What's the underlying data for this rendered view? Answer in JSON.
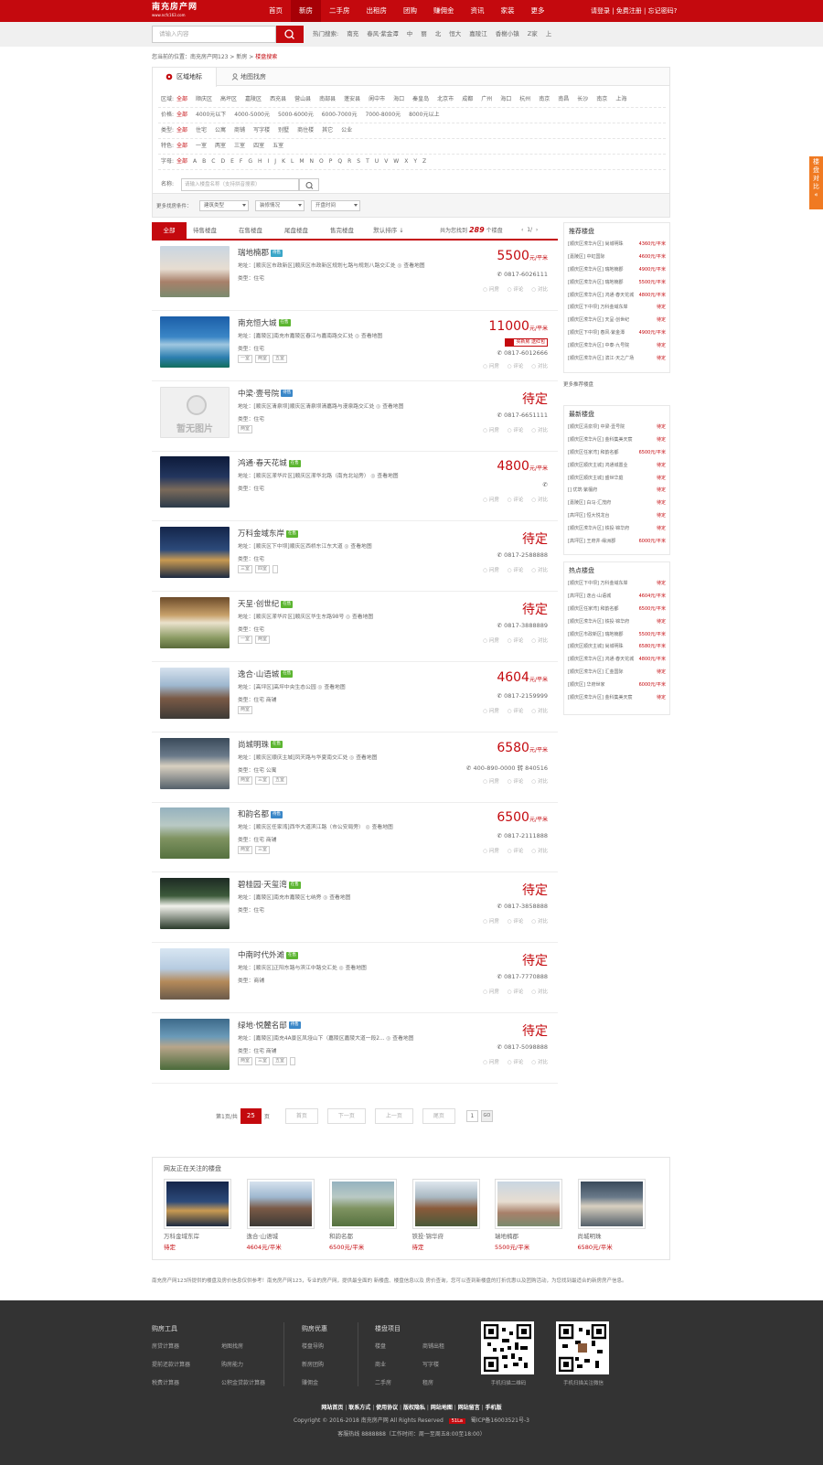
{
  "header": {
    "logo_text": "南充房产网",
    "logo_sub": "www.ncfc163.com",
    "nav": [
      "首页",
      "新房",
      "二手房",
      "出租房",
      "团购",
      "赚佣金",
      "资讯",
      "家装",
      "更多"
    ],
    "active_nav": 1,
    "login": "请登录",
    "register": "免费注册",
    "forgot": "忘记密码?"
  },
  "search": {
    "placeholder": "请输入内容",
    "hot_label": "热门搜索:",
    "hot_words": [
      "南充",
      "春风·紫金潭",
      "中",
      "丽",
      "北",
      "恒大",
      "嘉陵江",
      "香榭小镇",
      "Z家",
      "上"
    ]
  },
  "breadcrumb": {
    "prefix": "您当前的位置：",
    "site": "南充房产网123",
    "section": "新房",
    "current": "楼盘搜索",
    "sep": ">"
  },
  "filters": {
    "tabs": [
      "区域地标",
      "地图找房"
    ],
    "region": {
      "label": "区域:",
      "options": [
        "全部",
        "顺庆区",
        "高坪区",
        "嘉陵区",
        "西充县",
        "营山县",
        "南部县",
        "蓬安县",
        "阆中市",
        "海口",
        "秦皇岛",
        "北京市",
        "成都",
        "广州",
        "海口",
        "杭州",
        "南京",
        "南昌",
        "长沙",
        "南京",
        "上海"
      ]
    },
    "price": {
      "label": "价格:",
      "options": [
        "全部",
        "4000元以下",
        "4000-5000元",
        "5000-6000元",
        "6000-7000元",
        "7000-8000元",
        "8000元以上"
      ]
    },
    "type": {
      "label": "类型:",
      "options": [
        "全部",
        "住宅",
        "公寓",
        "商铺",
        "写字楼",
        "别墅",
        "商住楼",
        "其它",
        "公业"
      ]
    },
    "feature": {
      "label": "特色:",
      "options": [
        "全部",
        "一室",
        "两室",
        "三室",
        "四室",
        "五室"
      ]
    },
    "letter": {
      "label": "字母:",
      "options": [
        "全部",
        "A",
        "B",
        "C",
        "D",
        "E",
        "F",
        "G",
        "H",
        "I",
        "J",
        "K",
        "L",
        "M",
        "N",
        "O",
        "P",
        "Q",
        "R",
        "S",
        "T",
        "U",
        "V",
        "W",
        "X",
        "Y",
        "Z"
      ]
    },
    "name": {
      "label": "名称:",
      "placeholder": "请输入楼盘名称（支持拼音搜索）"
    },
    "more_label": "更多找房条件：",
    "selects": [
      "建筑类型",
      "装修情况",
      "开盘时间"
    ]
  },
  "list": {
    "tabs": [
      "全部",
      "待售楼盘",
      "在售楼盘",
      "尾盘楼盘",
      "售完楼盘"
    ],
    "sort": "默认排序 ↓",
    "total_prefix": "共为您找到",
    "total": "289",
    "total_suffix": "个楼盘",
    "page": "1/",
    "items": [
      {
        "name": "瑞地楠郡",
        "badge": "待售",
        "badge_color": "#3aa6c8",
        "addr": "地址：[顺庆区市政新区]顺庆区市政新区规划七路与规划八路交汇处",
        "map": "查看地图",
        "type": "类型：住宅",
        "tags": [],
        "price": "5500",
        "unit": "元/平米",
        "phone": "0817-6026111",
        "img": "linear-gradient(180deg,#c9d6e2 0%,#e7ddd1 45%,#a8806a 70%,#7a8a6e 100%)"
      },
      {
        "name": "南充恒大城",
        "badge": "在售",
        "badge_color": "#5cb531",
        "addr": "地址：[嘉陵区]南充市嘉陵区春江与嘉南路交汇处",
        "map": "查看地图",
        "type": "类型：住宅",
        "tags": [
          "一室",
          "两室",
          "五室"
        ],
        "price": "11000",
        "unit": "元/平米",
        "phone": "0817-6012666",
        "promo": "买新房 送红包",
        "img": "linear-gradient(180deg,#1b5ea8 0%,#3a86c6 40%,#9fc7e0 55%,#2d7fb0 80%,#126e5c 100%)"
      },
      {
        "name": "中梁·壹号院",
        "badge": "待售",
        "badge_color": "#3a87c8",
        "addr": "地址：[顺庆区清泉坝]顺庆区清泉坝清嘉路与漫泉路交汇处",
        "map": "查看地图",
        "type": "类型：住宅",
        "tags": [
          "两室"
        ],
        "price": "待定",
        "unit": "",
        "phone": "0817-6651111",
        "noimg": true,
        "noimg_text": "暂无图片"
      },
      {
        "name": "鸿通·春天花城",
        "badge": "在售",
        "badge_color": "#5cb531",
        "addr": "地址：[顺庆区潆华片区]顺庆区潆华北路（南充北站旁）",
        "map": "查看地图",
        "type": "类型：住宅",
        "tags": [],
        "price": "4800",
        "unit": "元/平米",
        "phone": "",
        "img": "linear-gradient(180deg,#0d1a3a 0%,#23365e 40%,#7a6a5a 65%,#2b3a4a 100%)"
      },
      {
        "name": "万科金域东岸",
        "badge": "在售",
        "badge_color": "#5cb531",
        "addr": "地址：[顺庆区下中坝]顺庆区西桥东江东大道",
        "map": "查看地图",
        "type": "类型：住宅",
        "tags": [
          "三室",
          "四室",
          ""
        ],
        "price": "待定",
        "unit": "",
        "phone": "0817-2588888",
        "img": "linear-gradient(180deg,#14254a 0%,#2c4a7a 45%,#c99a52 65%,#1c2a42 100%)"
      },
      {
        "name": "天呈·创世纪",
        "badge": "在售",
        "badge_color": "#5cb531",
        "addr": "地址：[顺庆区潆华片区]顺庆区华生东路98号",
        "map": "查看地图",
        "type": "类型：住宅",
        "tags": [
          "一室",
          "两室"
        ],
        "price": "待定",
        "unit": "",
        "phone": "0817-3888889",
        "img": "linear-gradient(180deg,#6c4b2a 0%,#c7a06a 35%,#eae2cc 50%,#8a9a62 80%,#5a6a3a 100%)"
      },
      {
        "name": "逸合·山语城",
        "badge": "在售",
        "badge_color": "#5cb531",
        "addr": "地址：[高坪区]高坪中央生态公园",
        "map": "查看地图",
        "type": "类型：住宅 商铺",
        "tags": [
          "两室"
        ],
        "price": "4604",
        "unit": "元/平米",
        "phone": "0817-2159999",
        "img": "linear-gradient(180deg,#d6e2ee 0%,#9eb7cf 35%,#7a5a46 60%,#3d3a36 100%)"
      },
      {
        "name": "尚城明珠",
        "badge": "在售",
        "badge_color": "#5cb531",
        "addr": "地址：[顺庆区顺庆主城]凤天路与华夏南交汇处",
        "map": "查看地图",
        "type": "类型：住宅 公寓",
        "tags": [
          "两室",
          "三室",
          "五室"
        ],
        "price": "6580",
        "unit": "元/平米",
        "phone": "400-890-0000 转 840516",
        "img": "linear-gradient(180deg,#3a4a5a 0%,#6a7a8a 35%,#d8d0c0 55%,#54606a 100%)"
      },
      {
        "name": "和韵名都",
        "badge": "待售",
        "badge_color": "#3a87c8",
        "addr": "地址：[顺庆区任家湾]西华大道滨江路（市公安局旁）",
        "map": "查看地图",
        "type": "类型：住宅 商铺",
        "tags": [
          "两室",
          "三室"
        ],
        "price": "6500",
        "unit": "元/平米",
        "phone": "0817-2111888",
        "img": "linear-gradient(180deg,#95b2bf 0%,#b9c9c4 35%,#7f9361 60%,#55713f 100%)"
      },
      {
        "name": "碧桂园·天玺湾",
        "badge": "在售",
        "badge_color": "#5cb531",
        "addr": "地址：[嘉陵区]南充市嘉陵区七纳旁",
        "map": "查看地图",
        "type": "类型：住宅",
        "tags": [],
        "price": "待定",
        "unit": "",
        "phone": "0817-3858888",
        "img": "linear-gradient(180deg,#1d2a24 0%,#3c5a3a 35%,#f2f2ec 55%,#2a3a2a 100%)"
      },
      {
        "name": "中南时代外滩",
        "badge": "在售",
        "badge_color": "#5cb531",
        "addr": "地址：[顺庆区]正阳东路与滨江中路交汇处",
        "map": "查看地图",
        "type": "类型：商铺",
        "tags": [],
        "price": "待定",
        "unit": "",
        "phone": "0817-7770888",
        "img": "linear-gradient(180deg,#d8e6f2 0%,#b6cbe0 40%,#b58a5a 65%,#6a5a4a 100%)"
      },
      {
        "name": "绿地·悦麓名邸",
        "badge": "待售",
        "badge_color": "#3a87c8",
        "addr": "地址：[嘉陵区]南充4A景区凤垭山下（嘉陵区嘉陵大道一段2...",
        "map": "查看地图",
        "type": "类型：住宅 商铺",
        "tags": [
          "两室",
          "三室",
          "五室",
          ""
        ],
        "price": "待定",
        "unit": "",
        "phone": "0817-5098888",
        "img": "linear-gradient(180deg,#3d6a8a 0%,#6a9ab8 35%,#b8a58a 55%,#4a6a3a 100%)"
      }
    ],
    "actions": [
      "问房",
      "评论",
      "对比"
    ]
  },
  "sidebar": {
    "recommend": {
      "title": "推荐楼盘",
      "rows": [
        [
          "[顺庆区潆华片区] 尚城明珠",
          "4360元/平米"
        ],
        [
          "[嘉陵区] 中虹国际",
          "4600元/平米"
        ],
        [
          "[顺庆区潆华片区] 瑞地楠郡",
          "4900元/平米"
        ],
        [
          "[顺庆区潆华片区] 瑞地楠郡",
          "5500元/平米"
        ],
        [
          "[顺庆区潆华片区] 鸿通·春天花城",
          "4800元/平米"
        ],
        [
          "[顺庆区下中坝] 万科金域东岸",
          "待定"
        ],
        [
          "[顺庆区潆华片区] 天呈·创世纪",
          "待定"
        ],
        [
          "[顺庆区下中坝] 春风·紫金潭",
          "4900元/平米"
        ],
        [
          "[顺庆区潆华片区] 中泰·九号院",
          "待定"
        ],
        [
          "[顺庆区潆华片区] 滨江·天之广场",
          "待定"
        ]
      ],
      "more": "更多推荐楼盘"
    },
    "newest": {
      "title": "最新楼盘",
      "rows": [
        [
          "[顺庆区清泉坝] 中梁·壹号院",
          "待定"
        ],
        [
          "[顺庆区潆华片区] 金科集美天宸",
          "待定"
        ],
        [
          "[顺庆区任家湾] 和韵名都",
          "6500元/平米"
        ],
        [
          "[顺庆区顺庆主城] 鸿通城置业",
          "待定"
        ],
        [
          "[顺庆区顺庆主城] 盛世华庭",
          "待定"
        ],
        [
          "[] 优筑·紫檀府",
          "待定"
        ],
        [
          "[嘉陵区] 白马·汇茂府",
          "待定"
        ],
        [
          "[高坪区] 恒大悦龙台",
          "待定"
        ],
        [
          "[顺庆区潆华片区] 铁投·锦华府",
          "待定"
        ],
        [
          "[高坪区] 王府井·缘洲郡",
          "6000元/平米"
        ]
      ]
    },
    "hot": {
      "title": "热点楼盘",
      "rows": [
        [
          "[顺庆区下中坝] 万科金域东岸",
          "待定"
        ],
        [
          "[高坪区] 逸合·山语城",
          "4604元/平米"
        ],
        [
          "[顺庆区任家湾] 和韵名都",
          "6500元/平米"
        ],
        [
          "[顺庆区潆华片区] 铁投·锦华府",
          "待定"
        ],
        [
          "[顺庆区市政新区] 瑞地楠郡",
          "5500元/平米"
        ],
        [
          "[顺庆区顺庆主城] 尚城明珠",
          "6580元/平米"
        ],
        [
          "[顺庆区潆华片区] 鸿通·春天花城",
          "4800元/平米"
        ],
        [
          "[顺庆区潆华片区] 汇金国际",
          "待定"
        ],
        [
          "[顺庆区] 华府世家",
          "6000元/平米"
        ],
        [
          "[顺庆区潆华片区] 金科集美天宸",
          "待定"
        ]
      ]
    }
  },
  "pager": {
    "prefix": "第1页/共",
    "current": "25",
    "suffix": "页",
    "first": "首页",
    "next": "下一页",
    "prev": "上一页",
    "last": "尾页",
    "go": "GO"
  },
  "following": {
    "title": "网友正在关注的楼盘",
    "cards": [
      {
        "name": "万科金域东岸",
        "price": "待定",
        "img": "linear-gradient(180deg,#14254a 0%,#2c4a7a 45%,#c99a52 65%,#1c2a42 100%)"
      },
      {
        "name": "逸合·山语城",
        "price": "4604元/平米",
        "img": "linear-gradient(180deg,#d6e2ee 0%,#9eb7cf 35%,#7a5a46 60%,#3d3a36 100%)"
      },
      {
        "name": "和韵名都",
        "price": "6500元/平米",
        "img": "linear-gradient(180deg,#95b2bf 0%,#b9c9c4 35%,#7f9361 60%,#55713f 100%)"
      },
      {
        "name": "铁投·锦华府",
        "price": "待定",
        "img": "linear-gradient(180deg,#dfe7ee 0%,#a9b8c2 35%,#8a5a3a 60%,#4a5a3a 100%)"
      },
      {
        "name": "瑞地楠郡",
        "price": "5500元/平米",
        "img": "linear-gradient(180deg,#c9d6e2 0%,#e7ddd1 45%,#a8806a 70%,#7a8a6e 100%)"
      },
      {
        "name": "尚城明珠",
        "price": "6580元/平米",
        "img": "linear-gradient(180deg,#3a4a5a 0%,#6a7a8a 35%,#d8d0c0 55%,#54606a 100%)"
      }
    ]
  },
  "disclaimer": "南充房产网123所提供的楼盘及房价信息仅供参考！南充房产网123，专业的房产网，提供最全面的 新楼盘、楼盘信息以及 房价查询，您可以查到新楼盘的打折优惠以及团购活动，为您找到最适合的新房房产信息。",
  "footer": {
    "cols": [
      {
        "title": "购房工具",
        "links": [
          "房贷计算器",
          "地图找房",
          "提前还款计算器",
          "购房能力",
          "税费计算器",
          "公积金贷款计算器"
        ]
      },
      {
        "title": "购房优惠",
        "links": [
          "楼盘导购",
          "新房团购",
          "赚佣金"
        ]
      },
      {
        "title": "楼盘项目",
        "links": [
          "楼盘",
          "商铺出租",
          "商业",
          "写字楼",
          "二手房",
          "租房"
        ]
      }
    ],
    "qr1_caption": "手机扫描二维码",
    "qr2_caption": "手机扫描关注微信",
    "links": [
      "网站首页",
      "联系方式",
      "使用协议",
      "版权隐私",
      "网站地图",
      "网站留言",
      "手机版"
    ],
    "copyright": "Copyright © 2016-2018 南充房产网 All Rights Reserved",
    "icp_badge": "51La",
    "icp": "蜀ICP备16003521号-3",
    "hotline": "客服热线 8888888（工作时间：周一至周五8:00至18:00）"
  },
  "side_tab": "楼盘对比"
}
